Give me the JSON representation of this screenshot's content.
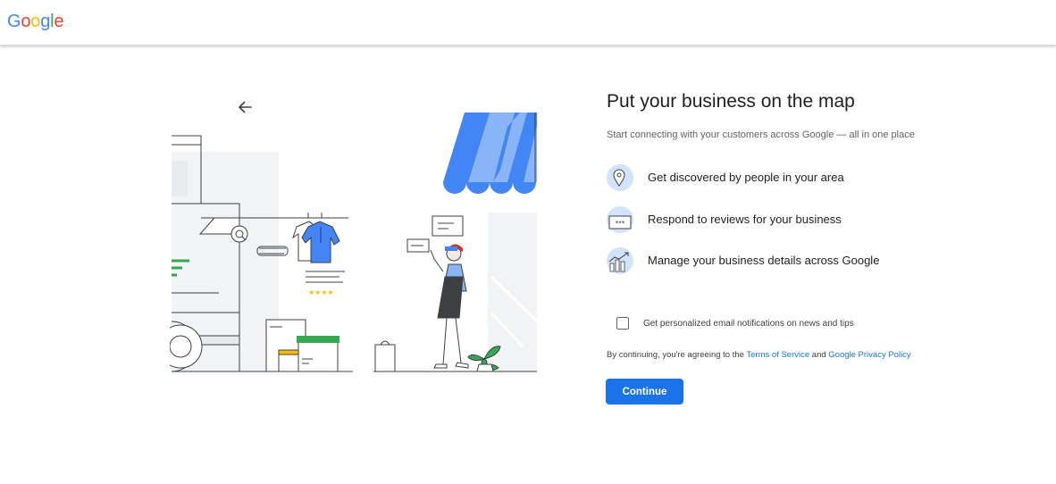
{
  "header": {
    "logo_letters": [
      "G",
      "o",
      "o",
      "g",
      "l",
      "e"
    ],
    "logo_colors": [
      "#4285F4",
      "#EA4335",
      "#FBBC05",
      "#4285F4",
      "#34A853",
      "#EA4335"
    ]
  },
  "main": {
    "title": "Put your business on the map",
    "subtitle": "Start connecting with your customers across Google — all in one place",
    "features": [
      {
        "icon": "location-pin-icon",
        "label": "Get discovered by people in your area"
      },
      {
        "icon": "review-stars-icon",
        "label": "Respond to reviews for your business"
      },
      {
        "icon": "growth-chart-icon",
        "label": "Manage your business details across Google"
      }
    ],
    "checkbox": {
      "label": "Get personalized email notifications on news and tips",
      "checked": false
    },
    "legal": {
      "prefix": "By continuing, you're agreeing to the ",
      "terms_link": "Terms of Service",
      "conjunction": " and ",
      "privacy_link": "Google Privacy Policy"
    },
    "continue_label": "Continue"
  },
  "illustration": {
    "rating_stars": "★★★★",
    "review_mask": "***"
  },
  "colors": {
    "accent": "#1a73e8",
    "light_blue": "#d2e3fc",
    "awning_dark": "#4285F4",
    "awning_light": "#8ab4f8",
    "green": "#34A853",
    "yellow": "#FBBC05",
    "text": "#202124",
    "muted": "#5f6368"
  }
}
